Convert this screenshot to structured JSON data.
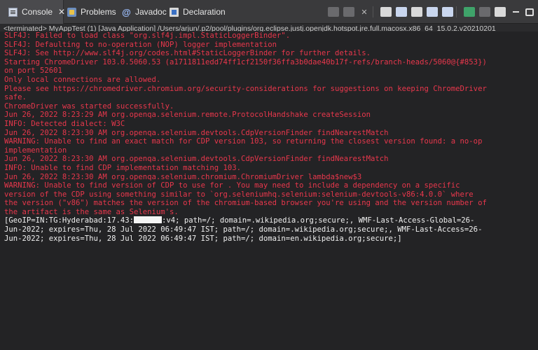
{
  "tabs": [
    {
      "label": "Console",
      "icon": "console-icon",
      "active": true,
      "close": "✕"
    },
    {
      "label": "Problems",
      "icon": "problems-icon"
    },
    {
      "label": "Javadoc",
      "icon": "javadoc-icon",
      "glyph": "@"
    },
    {
      "label": "Declaration",
      "icon": "declaration-icon"
    }
  ],
  "status_line": "<terminated> MyAppTest (1) [Java Application] /Users/arjun/.p2/pool/plugins/org.eclipse.justj.openjdk.hotspot.jre.full.macosx.x86_64_15.0.2.v20210201",
  "console": {
    "lines": [
      {
        "text": "SLF4J: Failed to load class \"org.slf4j.impl.StaticLoggerBinder\".",
        "kind": "err"
      },
      {
        "text": "SLF4J: Defaulting to no-operation (NOP) logger implementation",
        "kind": "err"
      },
      {
        "text": "SLF4J: See http://www.slf4j.org/codes.html#StaticLoggerBinder for further details.",
        "kind": "err"
      },
      {
        "text": "Starting ChromeDriver 103.0.5060.53 (a1711811edd74ff1cf2150f36ffa3b0dae40b17f-refs/branch-heads/5060@{#853})",
        "kind": "err"
      },
      {
        "text": "on port 52601",
        "kind": "err"
      },
      {
        "text": "Only local connections are allowed.",
        "kind": "err"
      },
      {
        "text": "Please see https://chromedriver.chromium.org/security-considerations for suggestions on keeping ChromeDriver",
        "kind": "err"
      },
      {
        "text": "safe.",
        "kind": "err"
      },
      {
        "text": "ChromeDriver was started successfully.",
        "kind": "err"
      },
      {
        "text": "Jun 26, 2022 8:23:29 AM org.openqa.selenium.remote.ProtocolHandshake createSession",
        "kind": "err"
      },
      {
        "text": "INFO: Detected dialect: W3C",
        "kind": "err"
      },
      {
        "text": "Jun 26, 2022 8:23:30 AM org.openqa.selenium.devtools.CdpVersionFinder findNearestMatch",
        "kind": "err"
      },
      {
        "text": "WARNING: Unable to find an exact match for CDP version 103, so returning the closest version found: a no-op",
        "kind": "err"
      },
      {
        "text": "implementation",
        "kind": "err"
      },
      {
        "text": "Jun 26, 2022 8:23:30 AM org.openqa.selenium.devtools.CdpVersionFinder findNearestMatch",
        "kind": "err"
      },
      {
        "text": "INFO: Unable to find CDP implementation matching 103.",
        "kind": "err"
      },
      {
        "text": "Jun 26, 2022 8:23:30 AM org.openqa.selenium.chromium.ChromiumDriver lambda$new$3",
        "kind": "err"
      },
      {
        "text": "WARNING: Unable to find version of CDP to use for . You may need to include a dependency on a specific",
        "kind": "err"
      },
      {
        "text": "version of the CDP using something similar to `org.seleniumhq.selenium:selenium-devtools-v86:4.0.0` where",
        "kind": "err"
      },
      {
        "text": "the version (\"v86\") matches the version of the chromium-based browser you're using and the version number of",
        "kind": "err"
      },
      {
        "text": "the artifact is the same as Selenium's.",
        "kind": "err"
      },
      {
        "text_before": "[GeoIP=IN:TG:Hyderabad:17.43:",
        "text_after": ":v4; path=/; domain=.wikipedia.org;secure;, WMF-Last-Access-Global=26-",
        "kind": "out",
        "redacted": true
      },
      {
        "text": "Jun-2022; expires=Thu, 28 Jul 2022 06:49:47 IST; path=/; domain=.wikipedia.org;secure;, WMF-Last-Access=26-",
        "kind": "out"
      },
      {
        "text": "Jun-2022; expires=Thu, 28 Jul 2022 06:49:47 IST; path=/; domain=en.wikipedia.org;secure;]",
        "kind": "out"
      }
    ]
  },
  "colors": {
    "error": "#e8374c",
    "output": "#f0f0f0",
    "background": "#232325"
  }
}
